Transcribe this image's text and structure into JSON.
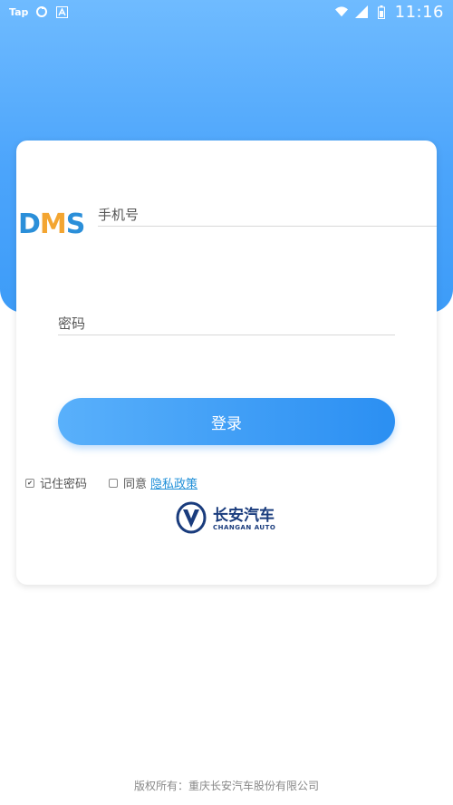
{
  "status_bar": {
    "app_label": "Tap",
    "time": "11:16",
    "icons": [
      "sync-icon",
      "a-badge-icon",
      "wifi-icon",
      "signal-icon",
      "battery-icon"
    ]
  },
  "header": {
    "bg_color": "#4ba4fb"
  },
  "logo": {
    "letters": [
      "D",
      "M",
      "S"
    ],
    "colors": {
      "blue": "#2b8fd9",
      "orange": "#f3a531"
    }
  },
  "login_form": {
    "phone_placeholder": "手机号",
    "phone_value": "",
    "password_placeholder": "密码",
    "password_value": "",
    "login_button": "登录"
  },
  "options": {
    "remember_label": "记住密码",
    "remember_checked": true,
    "agree_label": "同意",
    "agree_checked": false,
    "privacy_link": "隐私政策"
  },
  "brand": {
    "name_cn": "长安汽车",
    "name_en": "CHANGAN AUTO",
    "color": "#1a3c7d"
  },
  "footer": {
    "copyright": "版权所有：重庆长安汽车股份有限公司"
  }
}
